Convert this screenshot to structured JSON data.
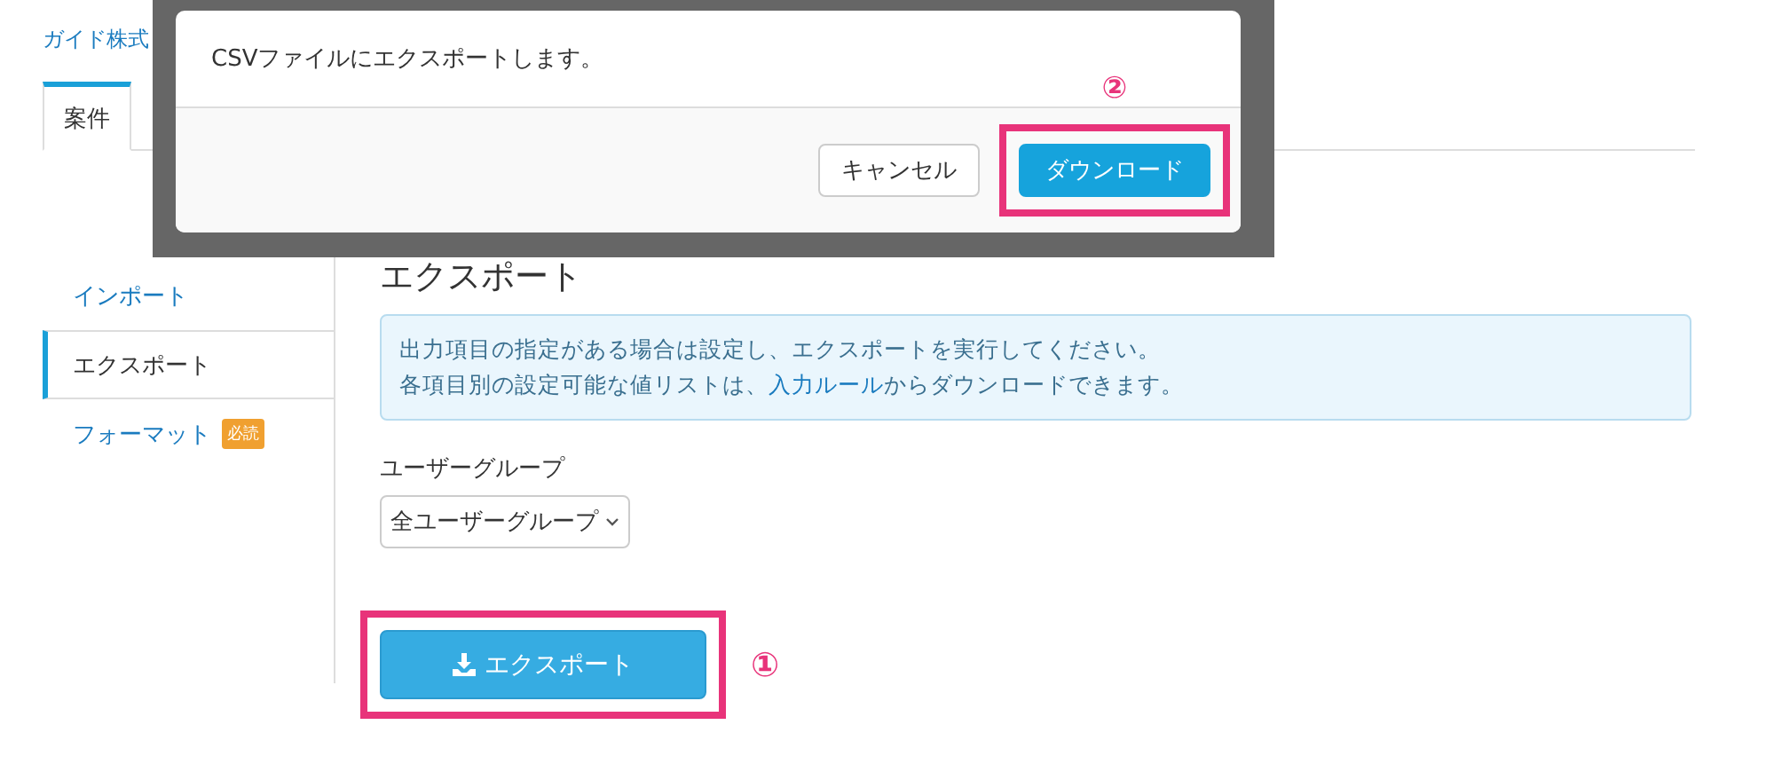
{
  "company": "ガイド株式",
  "tabs": [
    {
      "label": "案件",
      "selected": true
    }
  ],
  "sidebar": {
    "items": [
      {
        "label": "インポート",
        "selected": false
      },
      {
        "label": "エクスポート",
        "selected": true
      },
      {
        "label": "フォーマット",
        "selected": false,
        "badge": "必読"
      }
    ]
  },
  "main": {
    "title": "エクスポート",
    "info": {
      "line_1": "出力項目の指定がある場合は設定し、エクスポートを実行してください。",
      "line_2_before": "各項目別の設定可能な値リストは、",
      "line_2_link": "入力ルール",
      "line_2_after": "からダウンロードできます。"
    },
    "field": {
      "label": "ユーザーグループ",
      "value": "全ユーザーグループ"
    },
    "export_button": {
      "label": "エクスポート",
      "highlighted": true,
      "marker": "①"
    }
  },
  "dialog": {
    "message": "CSVファイルにエクスポートします。",
    "buttons": [
      {
        "label": "キャンセル",
        "kind": "secondary",
        "highlighted": false
      },
      {
        "label": "ダウンロード",
        "kind": "primary",
        "highlighted": true,
        "marker": "②"
      }
    ]
  }
}
